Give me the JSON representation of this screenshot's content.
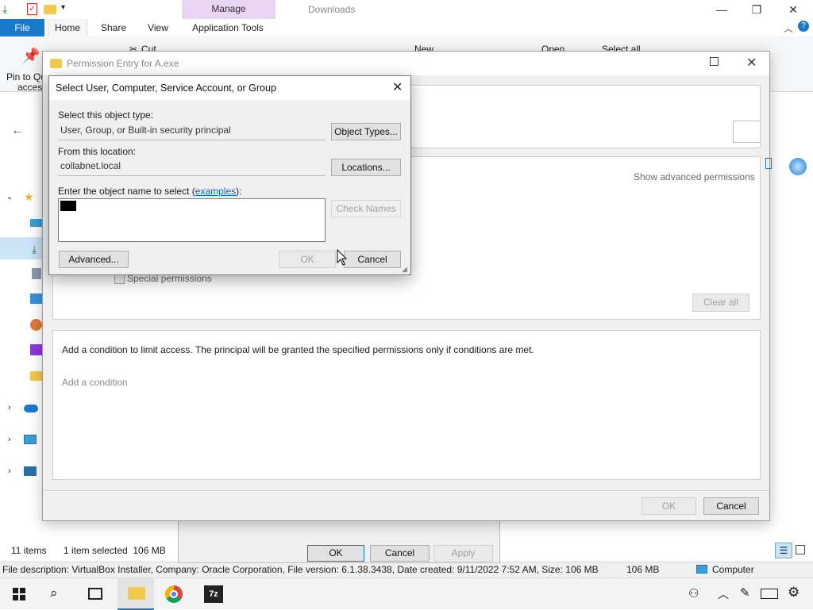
{
  "explorer": {
    "context_tab": "Manage",
    "window_title": "Downloads",
    "tabs": [
      "File",
      "Home",
      "Share",
      "View",
      "Application Tools"
    ],
    "ribbon_items": {
      "cut": "Cut",
      "new": "New",
      "open": "Open",
      "select_all": "Select all",
      "pin_line1": "Pin to Qu",
      "pin_line2": "access"
    },
    "status": {
      "items": "11 items",
      "selected": "1 item selected  106 MB"
    },
    "info": {
      "description": "File description: VirtualBox Installer, Company: Oracle Corporation, File version: 6.1.38.3438, Date created: 9/11/2022 7:52 AM, Size: 106 MB",
      "size": "106 MB",
      "computer": "Computer"
    }
  },
  "properties_dialog": {
    "ok": "OK",
    "cancel": "Cancel",
    "apply": "Apply"
  },
  "permission_entry": {
    "title": "Permission Entry for A.exe",
    "show_advanced": "Show advanced permissions",
    "special_permissions": "Special permissions",
    "clear_all": "Clear all",
    "condition_text": "Add a condition to limit access. The principal will be granted the specified permissions only if conditions are met.",
    "add_condition": "Add a condition",
    "ok": "OK",
    "cancel": "Cancel"
  },
  "select_dialog": {
    "title": "Select User, Computer, Service Account, or Group",
    "object_type_label": "Select this object type:",
    "object_type_value": "User, Group, or Built-in security principal",
    "object_types_button": "Object Types...",
    "location_label": "From this location:",
    "location_value": "collabnet.local",
    "locations_button": "Locations...",
    "enter_label_prefix": "Enter the object name to select (",
    "enter_label_link": "examples",
    "enter_label_suffix": "):",
    "check_names_button": "Check Names",
    "advanced_button": "Advanced...",
    "ok_button": "OK",
    "cancel_button": "Cancel"
  },
  "colors": {
    "file_tab": "#1979ca",
    "manage_tab": "#e8d4f3",
    "link": "#0066cc",
    "primary_border": "#0078d7"
  }
}
